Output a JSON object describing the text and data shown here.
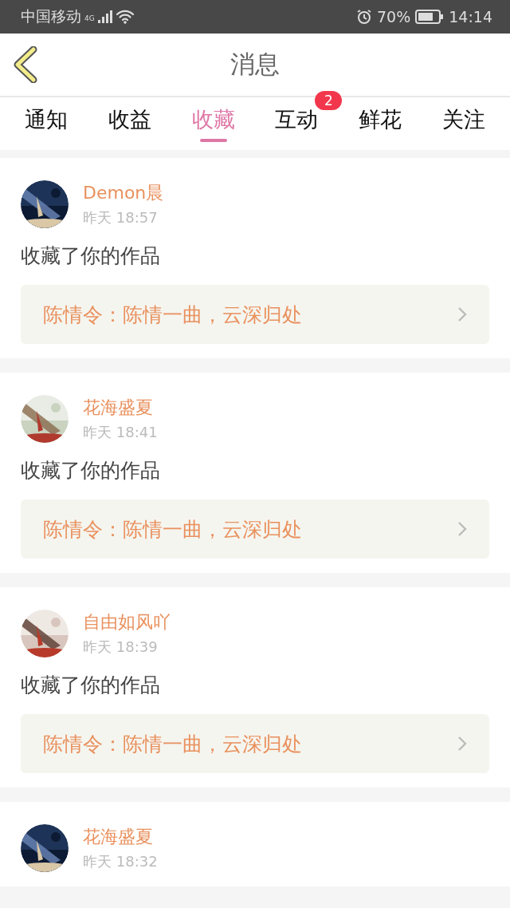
{
  "status_bar": {
    "carrier": "中国移动",
    "network": "4G",
    "battery": "70%",
    "time": "14:14"
  },
  "header": {
    "title": "消息"
  },
  "tabs": [
    {
      "label": "通知",
      "selected": false
    },
    {
      "label": "收益",
      "selected": false
    },
    {
      "label": "收藏",
      "selected": true
    },
    {
      "label": "互动",
      "selected": false,
      "badge": "2"
    },
    {
      "label": "鲜花",
      "selected": false
    },
    {
      "label": "关注",
      "selected": false
    }
  ],
  "messages": [
    {
      "name": "Demon晨",
      "time": "昨天 18:57",
      "action": "收藏了你的作品",
      "work": "陈情令：陈情一曲，云深归处"
    },
    {
      "name": "花海盛夏",
      "time": "昨天 18:41",
      "action": "收藏了你的作品",
      "work": "陈情令：陈情一曲，云深归处"
    },
    {
      "name": "自由如风吖",
      "time": "昨天 18:39",
      "action": "收藏了你的作品",
      "work": "陈情令：陈情一曲，云深归处"
    },
    {
      "name": "花海盛夏",
      "time": "昨天 18:32"
    }
  ]
}
